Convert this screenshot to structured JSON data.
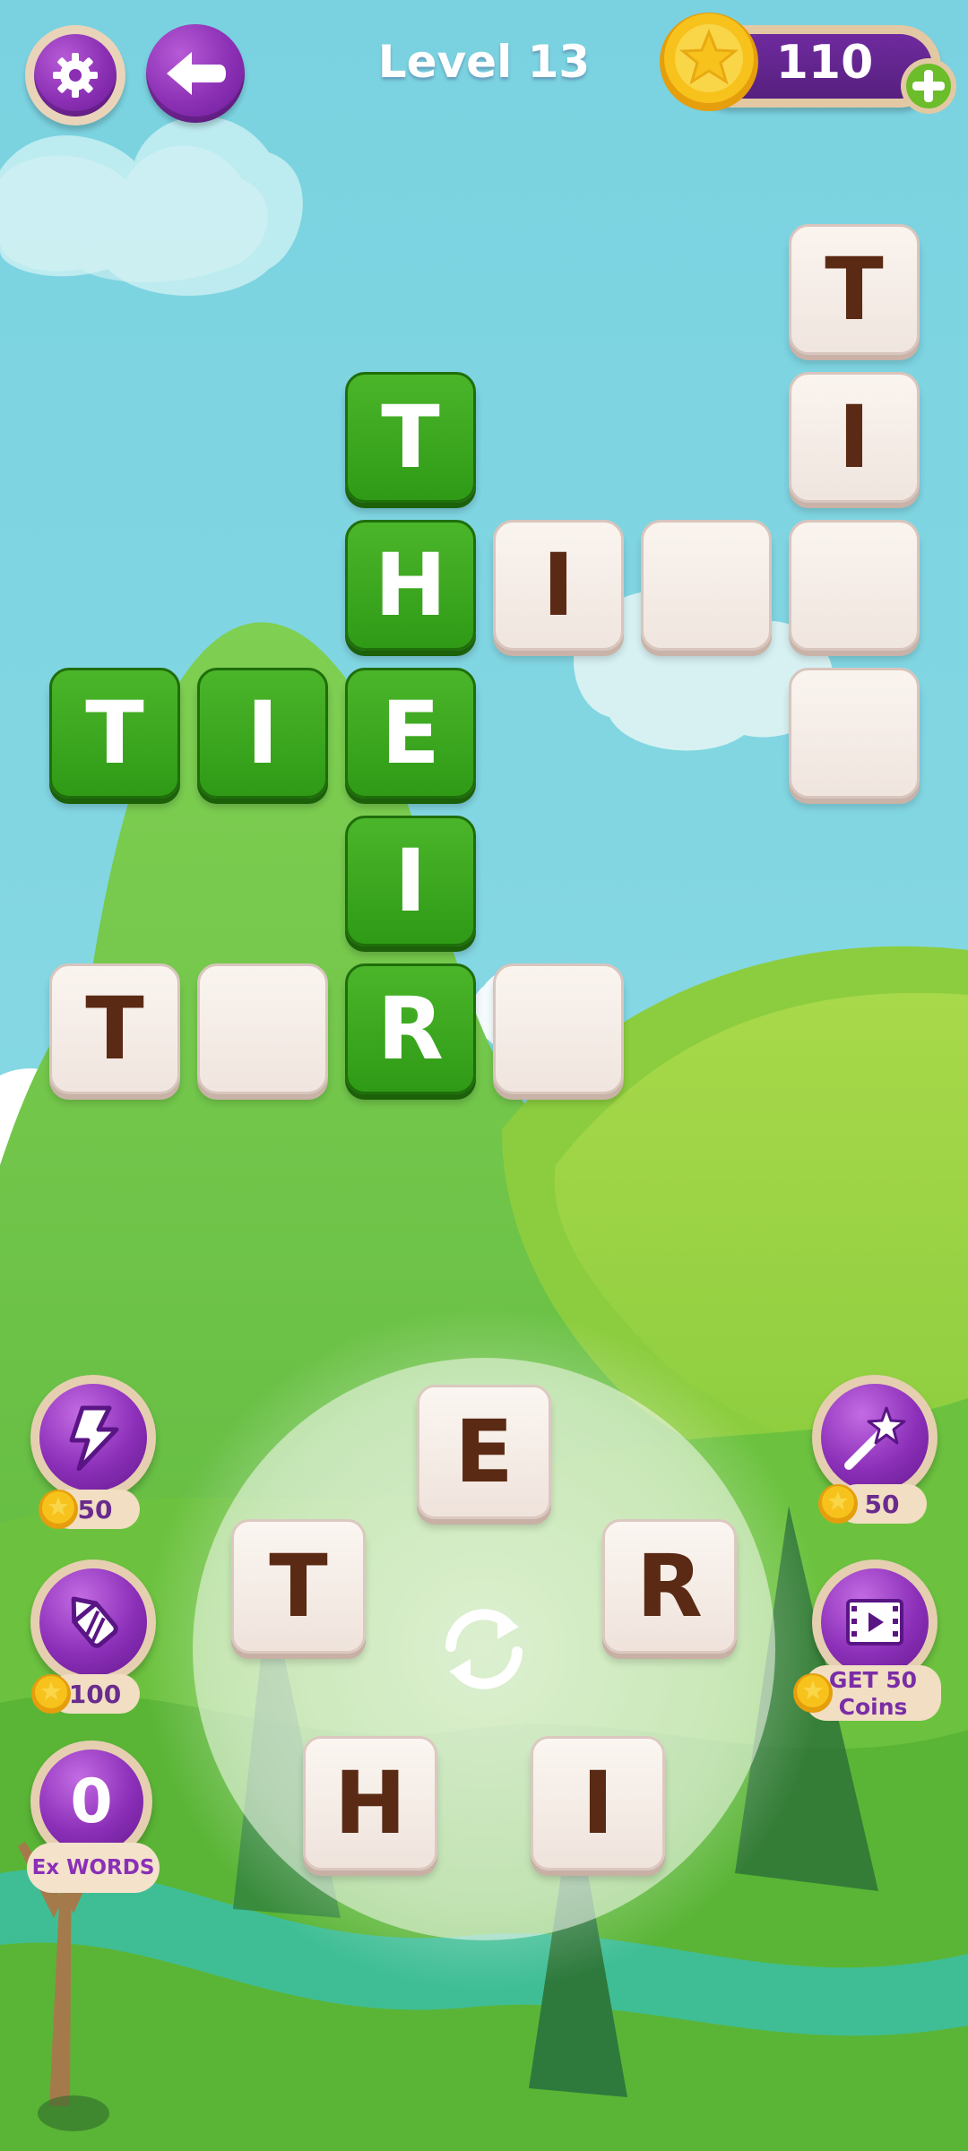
{
  "header": {
    "level_title": "Level 13",
    "coins": "110",
    "icons": [
      "gear-icon",
      "back-arrow-icon",
      "coin-icon",
      "plus-icon"
    ]
  },
  "grid": {
    "cells": [
      {
        "r": 0,
        "c": 5,
        "letter": "T",
        "state": "revealed"
      },
      {
        "r": 1,
        "c": 2,
        "letter": "T",
        "state": "found"
      },
      {
        "r": 1,
        "c": 5,
        "letter": "I",
        "state": "revealed"
      },
      {
        "r": 2,
        "c": 2,
        "letter": "H",
        "state": "found"
      },
      {
        "r": 2,
        "c": 3,
        "letter": "I",
        "state": "revealed"
      },
      {
        "r": 2,
        "c": 4,
        "letter": "",
        "state": "empty"
      },
      {
        "r": 2,
        "c": 5,
        "letter": "",
        "state": "empty"
      },
      {
        "r": 3,
        "c": 0,
        "letter": "T",
        "state": "found"
      },
      {
        "r": 3,
        "c": 1,
        "letter": "I",
        "state": "found"
      },
      {
        "r": 3,
        "c": 2,
        "letter": "E",
        "state": "found"
      },
      {
        "r": 3,
        "c": 5,
        "letter": "",
        "state": "empty"
      },
      {
        "r": 4,
        "c": 2,
        "letter": "I",
        "state": "found"
      },
      {
        "r": 5,
        "c": 0,
        "letter": "T",
        "state": "revealed"
      },
      {
        "r": 5,
        "c": 1,
        "letter": "",
        "state": "empty"
      },
      {
        "r": 5,
        "c": 2,
        "letter": "R",
        "state": "found"
      },
      {
        "r": 5,
        "c": 3,
        "letter": "",
        "state": "empty"
      }
    ]
  },
  "wheel": {
    "letters": [
      "E",
      "T",
      "R",
      "H",
      "I"
    ],
    "shuffle_icon": "shuffle-icon"
  },
  "powerups": {
    "lightning": {
      "icon": "lightning-icon",
      "price": "50"
    },
    "rocket": {
      "icon": "rocket-icon",
      "price": "100"
    },
    "extra_words": {
      "count": "0",
      "label": "Ex WORDS"
    },
    "magic_wand": {
      "icon": "magic-wand-icon",
      "price": "50"
    },
    "video": {
      "icon": "video-icon",
      "label_line1": "GET 50",
      "label_line2": "Coins"
    }
  },
  "colors": {
    "sky": "#7dd3df",
    "found_tile": "#3aa51e",
    "blank_tile": "#f6ede8",
    "purple": "#8a2fb8",
    "coin_gold": "#f7c21c"
  }
}
